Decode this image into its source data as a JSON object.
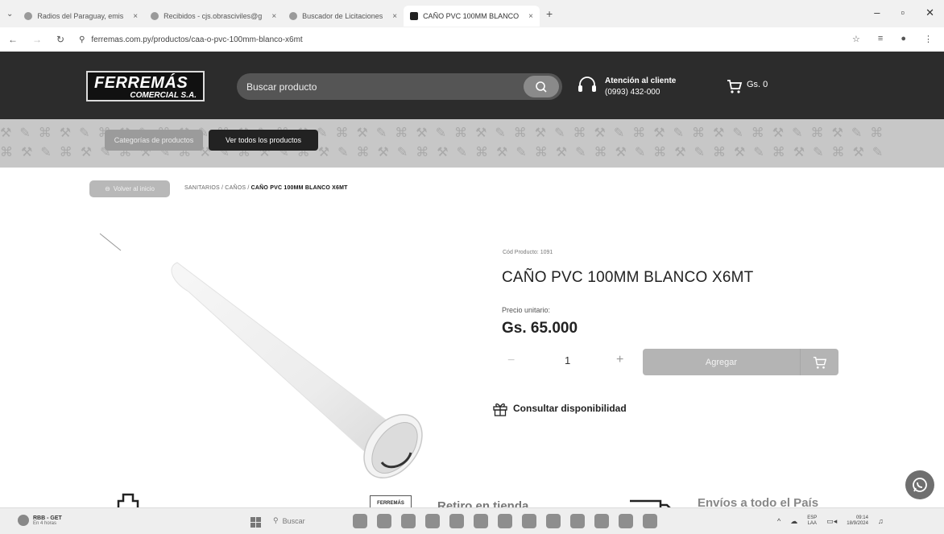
{
  "browser": {
    "tabs": [
      {
        "label": "Radios del Paraguay, emis",
        "active": false
      },
      {
        "label": "Recibidos - cjs.obrasciviles@g",
        "active": false
      },
      {
        "label": "Buscador de Licitaciones",
        "active": false
      },
      {
        "label": "CAÑO PVC 100MM BLANCO",
        "active": true
      }
    ],
    "new_tab": "+",
    "url": "ferremas.com.py/productos/caa-o-pvc-100mm-blanco-x6mt"
  },
  "header": {
    "logo_line1": "FERREMÁS",
    "logo_line2": "COMERCIAL S.A.",
    "search_placeholder": "Buscar producto",
    "support_title": "Atención al cliente",
    "support_phone": "(0993) 432-000",
    "cart_total": "Gs. 0"
  },
  "category_strip": {
    "categories_button": "Categorías de productos",
    "all_products_button": "Ver todos los productos"
  },
  "breadcrumb": {
    "back_button": "Volver al inicio",
    "path": "SANITARIOS / CAÑOS /",
    "current": "CAÑO PVC 100MM BLANCO X6MT"
  },
  "product": {
    "code": "Cód Producto: 1091",
    "title": "CAÑO PVC 100MM BLANCO X6MT",
    "price_label": "Precio unitario:",
    "price": "Gs. 65.000",
    "quantity": "1",
    "qty_minus": "−",
    "qty_plus": "+",
    "add_button": "Agregar",
    "availability": "Consultar disponibilidad"
  },
  "features": {
    "logo_text": "FERREMÁS",
    "pickup": "Retiro en tienda",
    "shipping": "Envíos a todo el País"
  },
  "taskbar": {
    "weather_title": "RBB - GET",
    "weather_sub": "En 4 horas",
    "search": "Buscar",
    "lang_1": "ESP",
    "lang_2": "LAA",
    "time": "09:14",
    "date": "18/9/2024"
  }
}
